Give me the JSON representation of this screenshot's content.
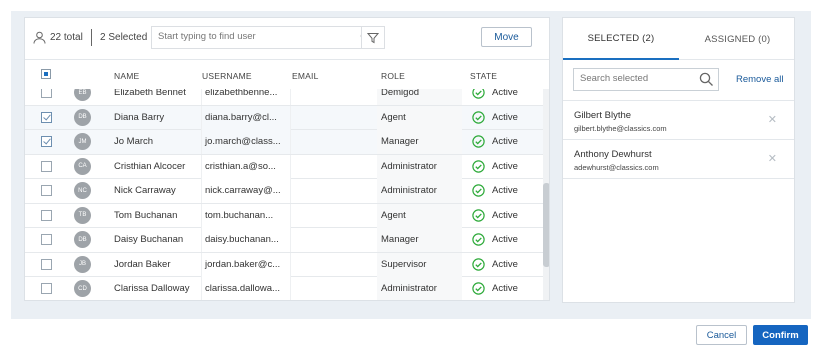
{
  "toolbar": {
    "total_label": "22 total",
    "selected_label": "2 Selected",
    "search_placeholder": "Start typing to find user",
    "move_label": "Move"
  },
  "table": {
    "headers": {
      "name": "NAME",
      "username": "USERNAME",
      "email": "EMAIL",
      "role": "ROLE",
      "state": "STATE"
    },
    "rows": [
      {
        "initials": "EB",
        "name": "Elizabeth Bennet",
        "username": "elizabethbenne...",
        "email": "",
        "role": "Demigod",
        "state": "Active",
        "checked": false
      },
      {
        "initials": "DB",
        "name": "Diana Barry",
        "username": "diana.barry@cl...",
        "email": "",
        "role": "Agent",
        "state": "Active",
        "checked": true
      },
      {
        "initials": "JM",
        "name": "Jo March",
        "username": "jo.march@class...",
        "email": "",
        "role": "Manager",
        "state": "Active",
        "checked": true
      },
      {
        "initials": "CA",
        "name": "Cristhian Alcocer",
        "username": "cristhian.a@so...",
        "email": "",
        "role": "Administrator",
        "state": "Active",
        "checked": false
      },
      {
        "initials": "NC",
        "name": "Nick Carraway",
        "username": "nick.carraway@...",
        "email": "",
        "role": "Administrator",
        "state": "Active",
        "checked": false
      },
      {
        "initials": "TB",
        "name": "Tom Buchanan",
        "username": "tom.buchanan...",
        "email": "",
        "role": "Agent",
        "state": "Active",
        "checked": false
      },
      {
        "initials": "DB",
        "name": "Daisy Buchanan",
        "username": "daisy.buchanan...",
        "email": "",
        "role": "Manager",
        "state": "Active",
        "checked": false
      },
      {
        "initials": "JB",
        "name": "Jordan Baker",
        "username": "jordan.baker@c...",
        "email": "",
        "role": "Supervisor",
        "state": "Active",
        "checked": false
      },
      {
        "initials": "CD",
        "name": "Clarissa Dalloway",
        "username": "clarissa.dallowa...",
        "email": "",
        "role": "Administrator",
        "state": "Active",
        "checked": false
      }
    ]
  },
  "tabs": {
    "selected_label": "SELECTED (2)",
    "assigned_label": "ASSIGNED (0)"
  },
  "selected_panel": {
    "search_placeholder": "Search selected",
    "remove_all_label": "Remove all",
    "items": [
      {
        "name": "Gilbert Blythe",
        "email": "gilbert.blythe@classics.com"
      },
      {
        "name": "Anthony Dewhurst",
        "email": "adewhurst@classics.com"
      }
    ]
  },
  "footer": {
    "cancel_label": "Cancel",
    "confirm_label": "Confirm"
  },
  "colors": {
    "accent": "#1565c0",
    "active_state": "#2eaa3a",
    "background": "#eaeff4"
  }
}
